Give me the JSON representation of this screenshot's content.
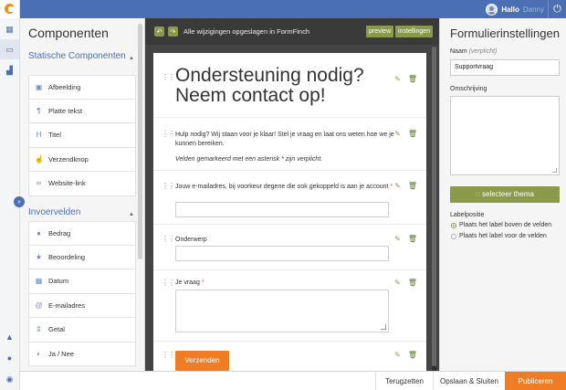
{
  "topbar": {
    "hello": "Hallo",
    "username": "Danny"
  },
  "components": {
    "title": "Componenten",
    "static": {
      "title": "Statische Componenten",
      "items": [
        {
          "label": "Afbeelding",
          "icon": "image-icon"
        },
        {
          "label": "Platte tekst",
          "icon": "paragraph-icon"
        },
        {
          "label": "Titel",
          "icon": "heading-icon"
        },
        {
          "label": "Verzendknop",
          "icon": "thumbs-up-icon"
        },
        {
          "label": "Website-link",
          "icon": "link-icon"
        }
      ]
    },
    "inputs": {
      "title": "Invoervelden",
      "items": [
        {
          "label": "Bedrag",
          "icon": "piggy-bank-icon"
        },
        {
          "label": "Beoordeling",
          "icon": "star-icon"
        },
        {
          "label": "Datum",
          "icon": "calendar-icon"
        },
        {
          "label": "E-mailadres",
          "icon": "at-icon"
        },
        {
          "label": "Getal",
          "icon": "sort-icon"
        },
        {
          "label": "Ja / Nee",
          "icon": "toggle-icon"
        }
      ]
    }
  },
  "editor": {
    "save_status": "Alle wijzigingen opgeslagen in FormFinch",
    "preview_label": "preview",
    "settings_label": "instellingen",
    "form": {
      "title": "Ondersteuning nodig? Neem contact op!",
      "intro": "Hulp nodig? Wij staan voor je klaar! Stel je vraag en laat ons weten hoe we je kunnen bereiken.",
      "required_note": "Velden gemarkeerd met een asterisk * zijn verplicht.",
      "email_label": "Jouw e-mailadres, bij voorkeur degene die ook gekoppeld is aan je account",
      "subject_label": "Onderwerp",
      "question_label": "Je vraag",
      "required_mark": "*",
      "submit_label": "Verzenden"
    }
  },
  "settings": {
    "title": "Formulierinstellingen",
    "name_label": "Naam",
    "name_hint": "(verplicht)",
    "name_value": "Supportvraag",
    "description_label": "Omschrijving",
    "theme_button": "selecteer thema",
    "label_position": "Labelpositie",
    "options": [
      {
        "label": "Plaats het label boven de velden",
        "selected": true
      },
      {
        "label": "Plaats het label voor de velden",
        "selected": false
      }
    ]
  },
  "footer": {
    "reset": "Terugzetten",
    "save_close": "Opslaan & Sluiten",
    "publish": "Publiceren"
  },
  "colors": {
    "primary": "#4b6fb3",
    "accent": "#f07d23",
    "olive": "#8b9a4a"
  }
}
